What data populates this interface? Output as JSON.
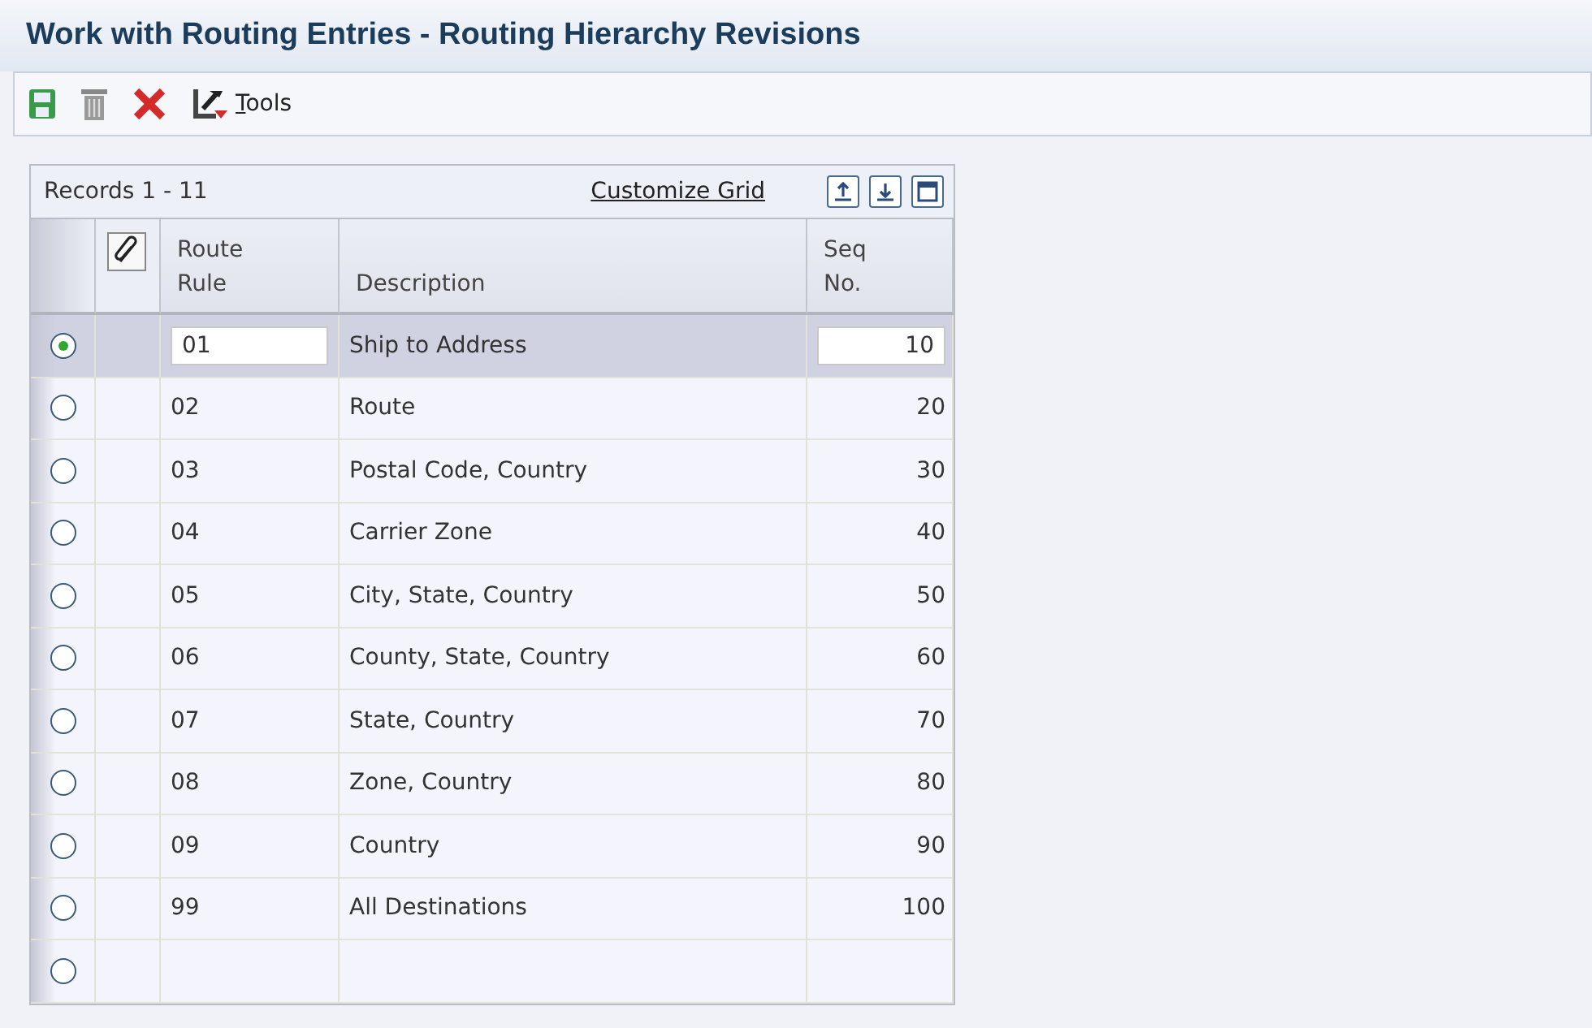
{
  "window": {
    "title": "Work with Routing Entries - Routing Hierarchy Revisions"
  },
  "toolbar": {
    "tools_label": "Tools"
  },
  "grid": {
    "records": "Records 1 - 11",
    "customize": "Customize Grid",
    "columns": [
      {
        "kind": "radio"
      },
      {
        "kind": "attach"
      },
      {
        "kind": "text",
        "label": "Route\nRule"
      },
      {
        "kind": "text",
        "label": "Description"
      },
      {
        "kind": "number",
        "label": "Seq\nNo."
      }
    ],
    "rows": [
      {
        "selected": true,
        "rule": "01",
        "description": "Ship to Address",
        "seq": "10"
      },
      {
        "selected": false,
        "rule": "02",
        "description": "Route",
        "seq": "20"
      },
      {
        "selected": false,
        "rule": "03",
        "description": "Postal Code, Country",
        "seq": "30"
      },
      {
        "selected": false,
        "rule": "04",
        "description": "Carrier Zone",
        "seq": "40"
      },
      {
        "selected": false,
        "rule": "05",
        "description": "City, State, Country",
        "seq": "50"
      },
      {
        "selected": false,
        "rule": "06",
        "description": "County, State, Country",
        "seq": "60"
      },
      {
        "selected": false,
        "rule": "07",
        "description": "State, Country",
        "seq": "70"
      },
      {
        "selected": false,
        "rule": "08",
        "description": "Zone, Country",
        "seq": "80"
      },
      {
        "selected": false,
        "rule": "09",
        "description": "Country",
        "seq": "90"
      },
      {
        "selected": false,
        "rule": "99",
        "description": "All Destinations",
        "seq": "100"
      },
      {
        "selected": false
      }
    ]
  }
}
